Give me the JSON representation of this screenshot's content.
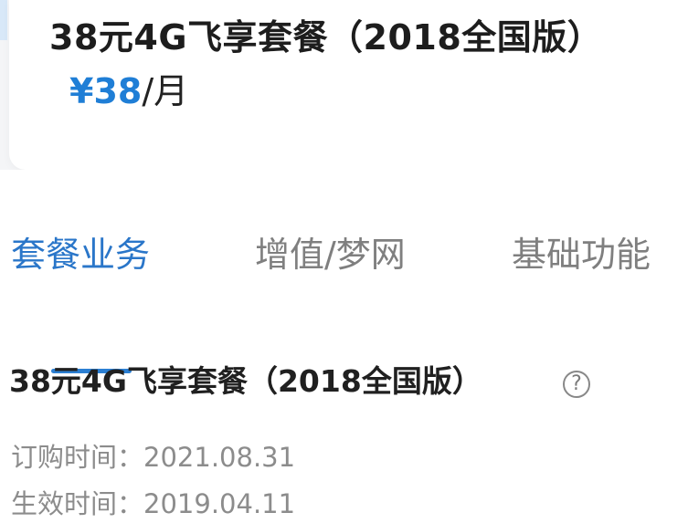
{
  "plan": {
    "title": "38元4G飞享套餐（2018全国版）",
    "price": "¥38",
    "price_unit": "/月"
  },
  "tabs": [
    {
      "label": "套餐业务",
      "active": true
    },
    {
      "label": "增值/梦网",
      "active": false
    },
    {
      "label": "基础功能",
      "active": false
    }
  ],
  "section": {
    "title": "38元4G飞享套餐（2018全国版）",
    "help_icon": "question-circle-icon"
  },
  "details": [
    {
      "label": "订购时间：",
      "value": "2021.08.31"
    },
    {
      "label": "生效时间：",
      "value": "2019.04.11"
    }
  ],
  "colors": {
    "accent": "#2a76c9",
    "price": "#1f7ed6",
    "muted": "#8c8c8c"
  }
}
